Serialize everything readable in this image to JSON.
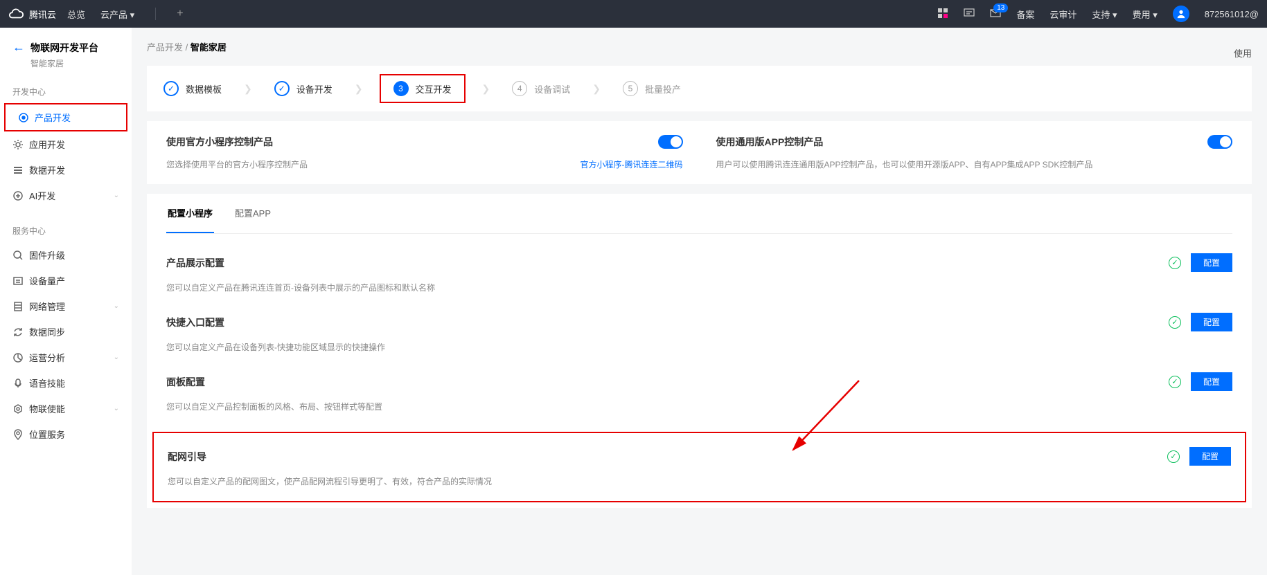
{
  "topbar": {
    "brand": "腾讯云",
    "overview": "总览",
    "products": "云产品",
    "beian": "备案",
    "audit": "云审计",
    "support": "支持",
    "fee": "费用",
    "mail_count": "13",
    "user": "872561012@"
  },
  "sidebar": {
    "back_title": "物联网开发平台",
    "back_sub": "智能家居",
    "group1": "开发中心",
    "items1": [
      {
        "key": "product-dev",
        "label": "产品开发",
        "active": true
      },
      {
        "key": "app-dev",
        "label": "应用开发"
      },
      {
        "key": "data-dev",
        "label": "数据开发"
      },
      {
        "key": "ai-dev",
        "label": "AI开发",
        "expandable": true
      }
    ],
    "group2": "服务中心",
    "items2": [
      {
        "key": "firmware",
        "label": "固件升级"
      },
      {
        "key": "device-mass",
        "label": "设备量产"
      },
      {
        "key": "network-mgmt",
        "label": "网络管理",
        "expandable": true
      },
      {
        "key": "data-sync",
        "label": "数据同步"
      },
      {
        "key": "ops-analytics",
        "label": "运营分析",
        "expandable": true
      },
      {
        "key": "voice-skill",
        "label": "语音技能"
      },
      {
        "key": "iot-enable",
        "label": "物联使能",
        "expandable": true
      },
      {
        "key": "location",
        "label": "位置服务"
      }
    ]
  },
  "breadcrumb": {
    "parent": "产品开发",
    "current": "智能家居",
    "sep": " / "
  },
  "steps": [
    {
      "n": "✓",
      "label": "数据模板",
      "status": "done"
    },
    {
      "n": "✓",
      "label": "设备开发",
      "status": "done"
    },
    {
      "n": "3",
      "label": "交互开发",
      "status": "current",
      "highlight": true
    },
    {
      "n": "4",
      "label": "设备调试",
      "status": "pending"
    },
    {
      "n": "5",
      "label": "批量投产",
      "status": "pending"
    }
  ],
  "controls": {
    "c1_title": "使用官方小程序控制产品",
    "c1_desc": "您选择使用平台的官方小程序控制产品",
    "c1_link": "官方小程序-腾讯连连二维码",
    "c2_title": "使用通用版APP控制产品",
    "c2_desc": "用户可以使用腾讯连连通用版APP控制产品，也可以使用开源版APP、自有APP集成APP SDK控制产品"
  },
  "sub_tabs": [
    "配置小程序",
    "配置APP"
  ],
  "sections": [
    {
      "key": "display",
      "title": "产品展示配置",
      "desc": "您可以自定义产品在腾讯连连首页-设备列表中展示的产品图标和默认名称",
      "btn": "配置"
    },
    {
      "key": "shortcut",
      "title": "快捷入口配置",
      "desc": "您可以自定义产品在设备列表-快捷功能区域显示的快捷操作",
      "btn": "配置"
    },
    {
      "key": "panel",
      "title": "面板配置",
      "desc": "您可以自定义产品控制面板的风格、布局、按钮样式等配置",
      "btn": "配置"
    },
    {
      "key": "network",
      "title": "配网引导",
      "desc": "您可以自定义产品的配网图文，使产品配网流程引导更明了、有效，符合产品的实际情况",
      "btn": "配置",
      "highlight": true
    }
  ],
  "usage_link": "使用"
}
